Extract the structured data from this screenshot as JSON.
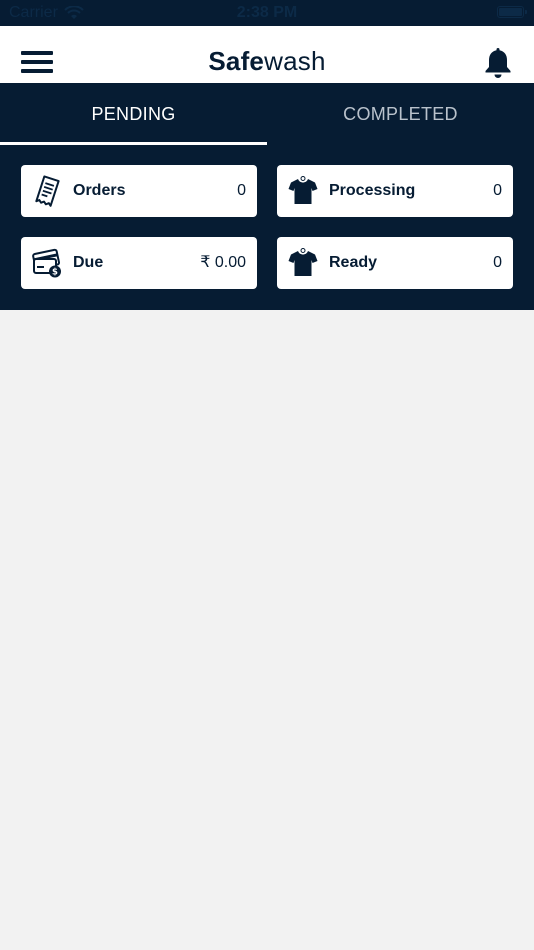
{
  "status_bar": {
    "carrier": "Carrier",
    "time": "2:38 PM"
  },
  "header": {
    "logo_bold": "Safe",
    "logo_light": "wash"
  },
  "tabs": [
    {
      "label": "PENDING",
      "active": true
    },
    {
      "label": "COMPLETED",
      "active": false
    }
  ],
  "cards": {
    "orders": {
      "label": "Orders",
      "value": "0",
      "icon": "receipt-icon"
    },
    "processing": {
      "label": "Processing",
      "value": "0",
      "icon": "tshirt-icon"
    },
    "due": {
      "label": "Due",
      "value": "₹ 0.00",
      "icon": "card-payment-icon"
    },
    "ready": {
      "label": "Ready",
      "value": "0",
      "icon": "tshirt-icon"
    }
  },
  "colors": {
    "primary": "#061c33",
    "background": "#f2f2f2",
    "inactive_tab": "#b9c2cc"
  }
}
